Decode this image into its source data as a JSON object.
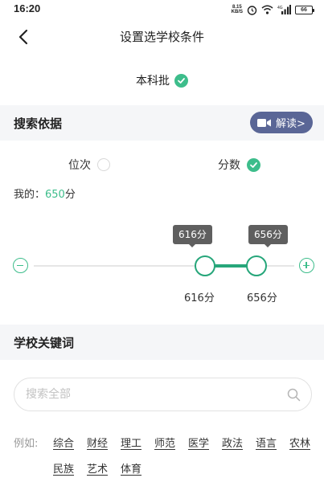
{
  "status_bar": {
    "time": "16:20",
    "net_speed_top": "8.15",
    "net_speed_bottom": "KB/S",
    "battery": "66"
  },
  "nav": {
    "title": "设置选学校条件"
  },
  "batch": {
    "label": "本科批",
    "selected": true
  },
  "basis_section": {
    "title": "搜索依据",
    "explain_label": "解读>"
  },
  "basis_options": [
    {
      "label": "位次",
      "selected": false
    },
    {
      "label": "分数",
      "selected": true
    }
  ],
  "my_score": {
    "prefix": "我的：",
    "value": "650",
    "unit": "分"
  },
  "score_range": {
    "min_tooltip": "616分",
    "max_tooltip": "656分",
    "min_label": "616分",
    "max_label": "656分"
  },
  "keyword_section": {
    "title": "学校关键词"
  },
  "search": {
    "placeholder": "搜索全部",
    "value": ""
  },
  "keywords": {
    "prefix": "例如:",
    "items": [
      "综合",
      "财经",
      "理工",
      "师范",
      "医学",
      "政法",
      "语言",
      "农林",
      "民族",
      "艺术",
      "体育"
    ]
  },
  "colors": {
    "accent": "#3dbd8b",
    "slider": "#26a67a",
    "explain_button": "#5a6696",
    "section_bg": "#f5f6f8"
  }
}
